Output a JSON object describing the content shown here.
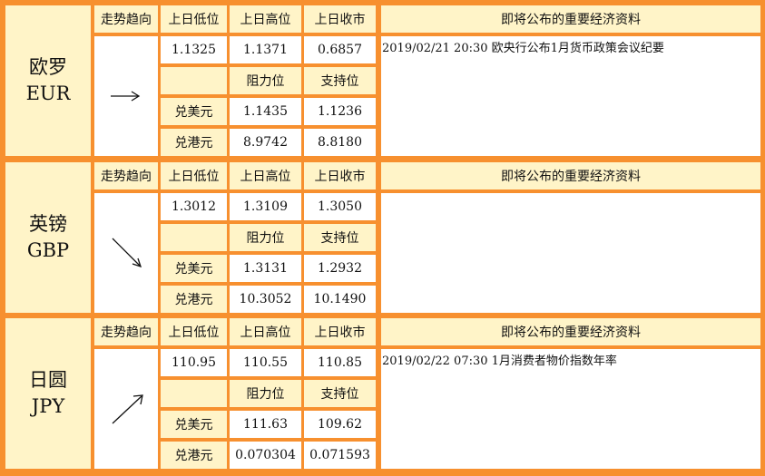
{
  "headers": {
    "trend": "走势趋向",
    "low": "上日低位",
    "high": "上日高位",
    "close": "上日收市",
    "resistance": "阻力位",
    "support": "支持位",
    "usd": "兑美元",
    "hkd": "兑港元",
    "news": "即将公布的重要经济资料"
  },
  "currencies": [
    {
      "name_cn": "欧罗",
      "code": "EUR",
      "trend": "flat",
      "low": "1.1325",
      "high": "1.1371",
      "close": "0.6857",
      "usd_resistance": "1.1435",
      "usd_support": "1.1236",
      "hkd_resistance": "8.9742",
      "hkd_support": "8.8180",
      "news": "2019/02/21 20:30 欧央行公布1月货币政策会议纪要"
    },
    {
      "name_cn": "英镑",
      "code": "GBP",
      "trend": "down",
      "low": "1.3012",
      "high": "1.3109",
      "close": "1.3050",
      "usd_resistance": "1.3131",
      "usd_support": "1.2932",
      "hkd_resistance": "10.3052",
      "hkd_support": "10.1490",
      "news": ""
    },
    {
      "name_cn": "日圆",
      "code": "JPY",
      "trend": "up",
      "low": "110.95",
      "high": "110.55",
      "close": "110.85",
      "usd_resistance": "111.63",
      "usd_support": "109.62",
      "hkd_resistance": "0.070304",
      "hkd_support": "0.071593",
      "news": "2019/02/22 07:30 1月消费者物价指数年率"
    }
  ],
  "colors": {
    "border": "#f7902f",
    "label_bg": "#fff4c8",
    "value_bg": "#ffffff"
  }
}
